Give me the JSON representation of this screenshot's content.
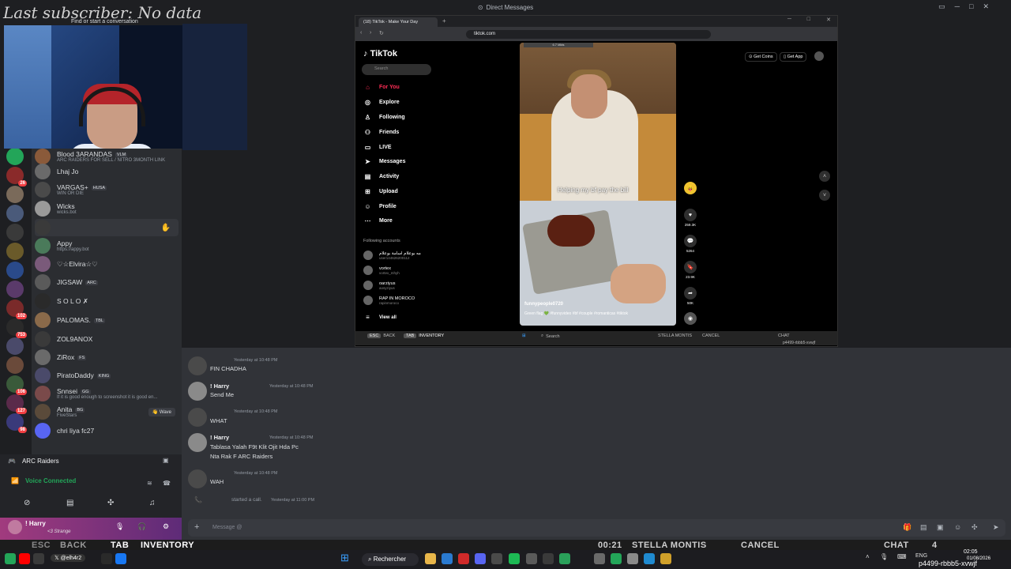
{
  "window": {
    "title": "Direct Messages"
  },
  "overlay": {
    "stream_title": "Last subscriber: No data",
    "find_conversation": "Find or start a conversation"
  },
  "dm_list": {
    "items": [
      {
        "name": "Blood 3ARANDAS",
        "tag": "VLM",
        "sub": "ARC RAIDERS FOR SELL / NITRO 3MONTH LINK"
      },
      {
        "name": "Lhaj Jo",
        "tag": "",
        "sub": ""
      },
      {
        "name": "VARGAS+",
        "tag": "HUSA",
        "sub": "WIN OR DIE"
      },
      {
        "name": "Wicks",
        "tag": "",
        "sub": "wicks.bot"
      },
      {
        "name": "",
        "tag": "",
        "sub": ""
      },
      {
        "name": "Appy",
        "tag": "",
        "sub": "https://appy.bot"
      },
      {
        "name": "♡☆Elvira☆♡",
        "tag": "",
        "sub": ""
      },
      {
        "name": "JIGSAW",
        "tag": "ARC",
        "sub": ""
      },
      {
        "name": "S O L O ✗",
        "tag": "",
        "sub": ""
      },
      {
        "name": "PALOMAS.",
        "tag": "TBL",
        "sub": ""
      },
      {
        "name": "ZOL9ANOX",
        "tag": "",
        "sub": ""
      },
      {
        "name": "ZiRox",
        "tag": "FS",
        "sub": ""
      },
      {
        "name": "PiratoDaddy",
        "tag": "KING",
        "sub": ""
      },
      {
        "name": "Snnsei",
        "tag": "GG",
        "sub": "If it is good enough to screenshot it is good en..."
      },
      {
        "name": "Anita",
        "tag": "BG",
        "sub": "FiveStars"
      },
      {
        "name": "chri liya fc27",
        "tag": "",
        "sub": ""
      }
    ],
    "wave_label": "Wave"
  },
  "voice": {
    "server": "ARC Raiders",
    "status": "Voice Connected"
  },
  "user": {
    "name": "Harry",
    "status": "<3 Strange"
  },
  "browser": {
    "tab_title": "(18) TikTok - Make Your Day",
    "url": "tiktok.com",
    "tiktok": {
      "logo": "TikTok",
      "search_placeholder": "Search",
      "nav": [
        "For You",
        "Explore",
        "Following",
        "Friends",
        "LIVE",
        "Messages",
        "Activity",
        "Upload",
        "Profile",
        "More"
      ],
      "following_accounts_label": "Following accounts",
      "following": [
        {
          "name": "مه بوعلام اسامة بوعلام",
          "sub": "user144626200112"
        },
        {
          "name": "vortex",
          "sub": "vortex_mhyh"
        },
        {
          "name": "oarziyus",
          "sub": "aosyziyus"
        },
        {
          "name": "RAP IN MOROCO",
          "sub": "rapinmoroco"
        }
      ],
      "view_all": "View all",
      "get_coins": "Get Coins",
      "get_app": "Get App",
      "video": {
        "caption": "Helping my bf pay the bill",
        "user": "funnypeople0720",
        "tags": "Green flag 💚 #funnyvideo #bf #couple #romanticas #tiktok",
        "top_pill": "6.7 Mkts"
      },
      "actions": [
        {
          "icon": "like-icon",
          "count": "259.3K"
        },
        {
          "icon": "comment-icon",
          "count": "5264"
        },
        {
          "icon": "bookmark-icon",
          "count": "23.9K"
        },
        {
          "icon": "share-icon",
          "count": "50K"
        }
      ]
    },
    "hud": {
      "esc": "ESC",
      "back": "BACK",
      "tab": "TAB",
      "inventory": "INVENTORY",
      "search": "Search",
      "stella": "STELLA MONTIS",
      "cancel": "CANCEL",
      "chat": "CHAT",
      "code": "p4499-rbbb5-xvwjf"
    }
  },
  "chat": {
    "messages": [
      {
        "author": "",
        "time": "Yesterday at 10:48 PM",
        "text": "FIN CHADHA"
      },
      {
        "author": "! Harry",
        "time": "Yesterday at 10:48 PM",
        "text": "Send Me"
      },
      {
        "author": "",
        "time": "Yesterday at 10:48 PM",
        "text": "WHAT"
      },
      {
        "author": "! Harry",
        "time": "Yesterday at 10:48 PM",
        "text": "Tablasa Yalah F9t Klit Ojit Hda Pc",
        "text2": "Nta Rak F ARC Raiders"
      },
      {
        "author": "",
        "time": "Yesterday at 10:48 PM",
        "text": "WAH"
      },
      {
        "author": "",
        "time": "Yesterday at 11:00 PM",
        "text": "started a call."
      }
    ],
    "input_placeholder": "Message @"
  },
  "game_bar": {
    "esc": "ESC",
    "back": "BACK",
    "tab": "TAB",
    "inventory": "INVENTORY",
    "timer": "00:21",
    "stella": "STELLA MONTIS",
    "cancel": "CANCEL",
    "chat": "CHAT",
    "squad": "4"
  },
  "taskbar": {
    "search": "Rechercher",
    "lang": "ENG",
    "time": "02:05",
    "date": "01/08/2026",
    "code": "p4499-rbbb5-xvwjf",
    "handle": "@elh4r2"
  }
}
